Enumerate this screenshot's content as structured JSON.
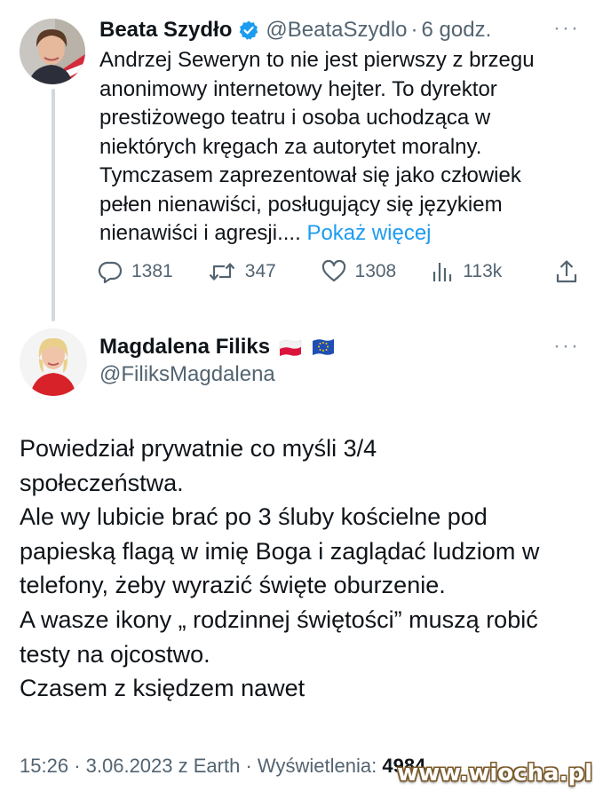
{
  "tweet1": {
    "author_name": "Beata Szydło",
    "handle": "@BeataSzydlo",
    "separator": "·",
    "time": "6 godz.",
    "body_lines": [
      "Andrzej Seweryn to nie jest pierwszy z brzegu",
      "anonimowy internetowy hejter. To dyrektor",
      "prestiżowego teatru i osoba uchodząca w",
      "niektórych kręgach za autorytet moralny.",
      "Tymczasem zaprezentował się jako człowiek",
      "pełen nienawiści, posługujący się językiem",
      "nienawiści i agresji...."
    ],
    "show_more": "Pokaż więcej",
    "more_menu": "···",
    "stats": {
      "replies": "1381",
      "retweets": "347",
      "likes": "1308",
      "views": "113k"
    },
    "verified_badge_color": "#1d9bf0"
  },
  "tweet2": {
    "author_name": "Magdalena Filiks",
    "flags": [
      "poland-flag-icon",
      "eu-flag-icon"
    ],
    "handle": "@FiliksMagdalena",
    "more_menu": "···",
    "body_lines": [
      "Powiedział prywatnie co myśli 3/4",
      "społeczeństwa.",
      "Ale wy lubicie brać po 3 śluby kościelne pod",
      "papieską flagą w imię Boga i zaglądać ludziom w",
      "telefony, żeby wyrazić święte oburzenie.",
      "A wasze ikony „ rodzinnej świętości” muszą robić",
      "testy na ojcostwo.",
      "Czasem z księdzem nawet"
    ],
    "meta": {
      "time": "15:26",
      "date": "3.06.2023",
      "source": "z Earth",
      "views_label": "Wyświetlenia:",
      "views": "4984"
    }
  },
  "watermark": "www.wiocha.pl",
  "colors": {
    "link": "#1d9bf0",
    "secondary_text": "#536471",
    "primary_text": "#0f1419"
  }
}
